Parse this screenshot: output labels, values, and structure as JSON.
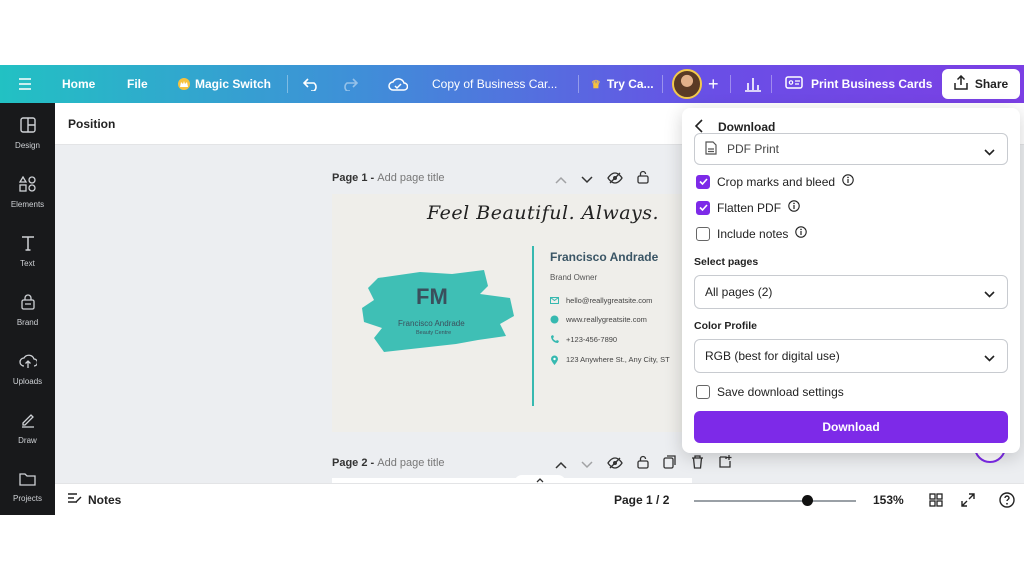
{
  "topbar": {
    "home": "Home",
    "file": "File",
    "magic_switch": "Magic Switch",
    "doc_title": "Copy of Business Car...",
    "try": "Try Ca...",
    "print": "Print Business Cards",
    "share": "Share"
  },
  "sidebar": {
    "items": [
      {
        "label": "Design",
        "icon": "layout-icon"
      },
      {
        "label": "Elements",
        "icon": "shapes-icon"
      },
      {
        "label": "Text",
        "icon": "text-icon"
      },
      {
        "label": "Brand",
        "icon": "brand-icon"
      },
      {
        "label": "Uploads",
        "icon": "upload-cloud-icon"
      },
      {
        "label": "Draw",
        "icon": "pen-icon"
      },
      {
        "label": "Projects",
        "icon": "folder-icon"
      }
    ]
  },
  "posbar": {
    "label": "Position"
  },
  "pages": [
    {
      "num": "Page 1 - ",
      "title_placeholder": "Add page title"
    },
    {
      "num": "Page 2 - ",
      "title_placeholder": "Add page title"
    }
  ],
  "card": {
    "tagline": "Feel Beautiful. Always.",
    "initials": "FM",
    "logo_name": "Francisco Andrade",
    "logo_sub": "Beauty Centre",
    "name": "Francisco Andrade",
    "role": "Brand Owner",
    "email": "hello@reallygreatsite.com",
    "website": "www.reallygreatsite.com",
    "phone": "+123-456-7890",
    "address": "123 Anywhere St., Any City, ST",
    "accent_color": "#36b9b0"
  },
  "bottombar": {
    "notes": "Notes",
    "page_indicator": "Page 1 / 2",
    "zoom": "153%",
    "zoom_slider_fraction": 0.7
  },
  "download": {
    "title": "Download",
    "file_type": "PDF Print",
    "crop_marks": {
      "label": "Crop marks and bleed",
      "checked": true
    },
    "flatten": {
      "label": "Flatten PDF",
      "checked": true
    },
    "include_notes": {
      "label": "Include notes",
      "checked": false
    },
    "select_pages_label": "Select pages",
    "select_pages_value": "All pages (2)",
    "color_profile_label": "Color Profile",
    "color_profile_value": "RGB (best for digital use)",
    "save_settings": {
      "label": "Save download settings",
      "checked": false
    },
    "button": "Download",
    "accent_color": "#7d2ae8"
  }
}
